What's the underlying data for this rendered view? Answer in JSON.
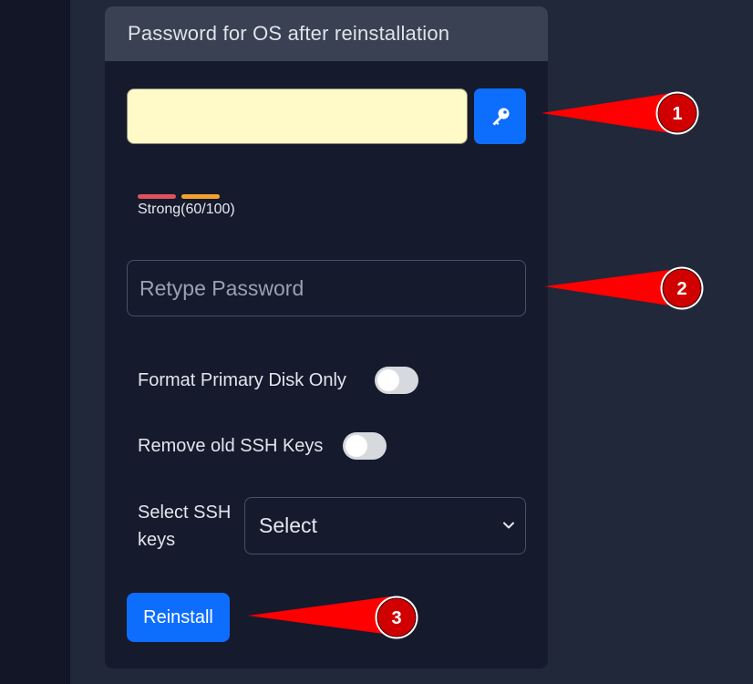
{
  "form": {
    "title": "Password for OS after reinstallation",
    "password": {
      "value": "",
      "placeholder": "",
      "generate_icon": "key-icon"
    },
    "strength": {
      "label": "Strong(60/100)",
      "score": 60,
      "max": 100,
      "bar_colors": [
        "#e0525b",
        "#f4a22d"
      ]
    },
    "retype": {
      "placeholder": "Retype Password"
    },
    "format_primary_disk": {
      "label": "Format Primary Disk Only",
      "checked": false
    },
    "remove_ssh_keys": {
      "label": "Remove old SSH Keys",
      "checked": false
    },
    "ssh_keys": {
      "label_line1": "Select SSH",
      "label_line2": "keys",
      "selected": "Select"
    },
    "reinstall_label": "Reinstall"
  },
  "annotations": [
    "1",
    "2",
    "3"
  ],
  "colors": {
    "accent": "#0d6efd",
    "annotation_red": "#ff0000"
  }
}
